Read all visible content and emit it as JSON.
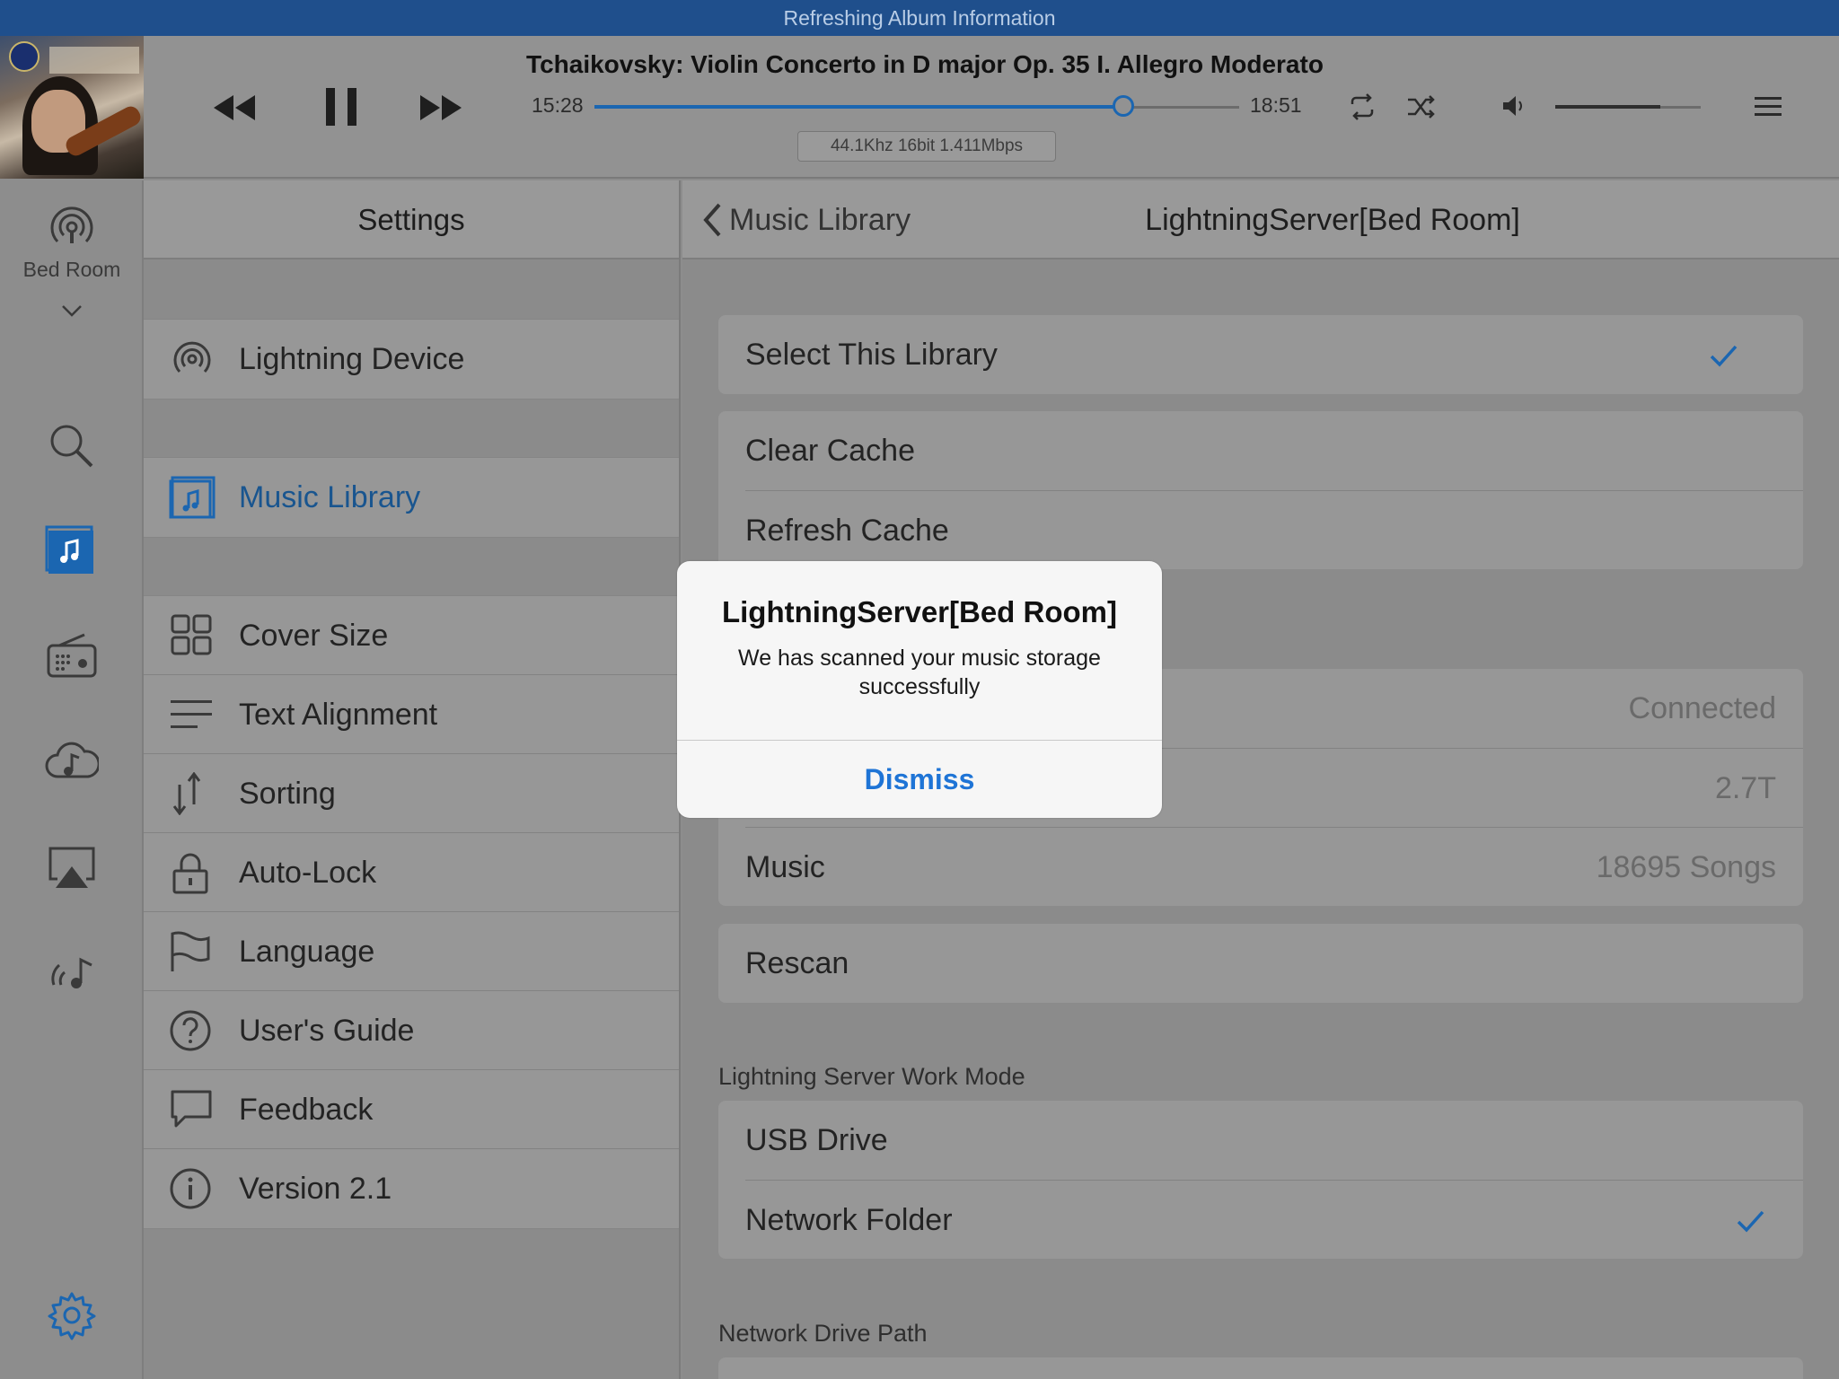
{
  "status_bar": {
    "text": "Refreshing Album Information"
  },
  "player": {
    "track_title": "Tchaikovsky: Violin Concerto in D major Op. 35 I. Allegro Moderato",
    "elapsed": "15:28",
    "duration": "18:51",
    "progress_fraction": 0.82,
    "audio_format": "44.1Khz  16bit  1.411Mbps",
    "volume_fraction": 0.72
  },
  "rail": {
    "zone_label": "Bed Room",
    "icons": [
      "broadcast-icon",
      "search-icon",
      "music-library-icon",
      "radio-icon",
      "cloud-music-icon",
      "airplay-icon",
      "streaming-music-icon",
      "gear-icon"
    ]
  },
  "settings": {
    "title": "Settings",
    "groups": [
      {
        "items": [
          {
            "label": "Lightning Device",
            "icon": "broadcast-icon"
          }
        ]
      },
      {
        "items": [
          {
            "label": "Music Library",
            "icon": "music-library-icon",
            "active": true
          }
        ]
      },
      {
        "items": [
          {
            "label": "Cover Size",
            "icon": "grid-icon"
          },
          {
            "label": "Text Alignment",
            "icon": "align-icon"
          },
          {
            "label": "Sorting",
            "icon": "sort-icon"
          },
          {
            "label": "Auto-Lock",
            "icon": "lock-icon"
          },
          {
            "label": "Language",
            "icon": "flag-icon"
          },
          {
            "label": "User's Guide",
            "icon": "help-icon"
          },
          {
            "label": "Feedback",
            "icon": "chat-icon"
          },
          {
            "label": "Version 2.1",
            "icon": "info-icon"
          }
        ]
      }
    ]
  },
  "detail": {
    "back_label": "Music Library",
    "title": "LightningServer[Bed Room]",
    "select_library": "Select This Library",
    "clear_cache": "Clear Cache",
    "refresh_cache": "Refresh Cache",
    "status_value": "Connected",
    "capacity_value": "2.7T",
    "music_label": "Music",
    "music_value": "18695 Songs",
    "rescan": "Rescan",
    "work_mode_header": "Lightning Server Work Mode",
    "usb_drive": "USB Drive",
    "network_folder": "Network Folder",
    "network_path_header": "Network Drive Path"
  },
  "alert": {
    "title": "LightningServer[Bed Room]",
    "message": "We has scanned your music storage successfully",
    "button": "Dismiss"
  },
  "colors": {
    "accent": "#1b66b1",
    "status_bar": "#1f4f8c",
    "dialog_button": "#1e74d6"
  }
}
